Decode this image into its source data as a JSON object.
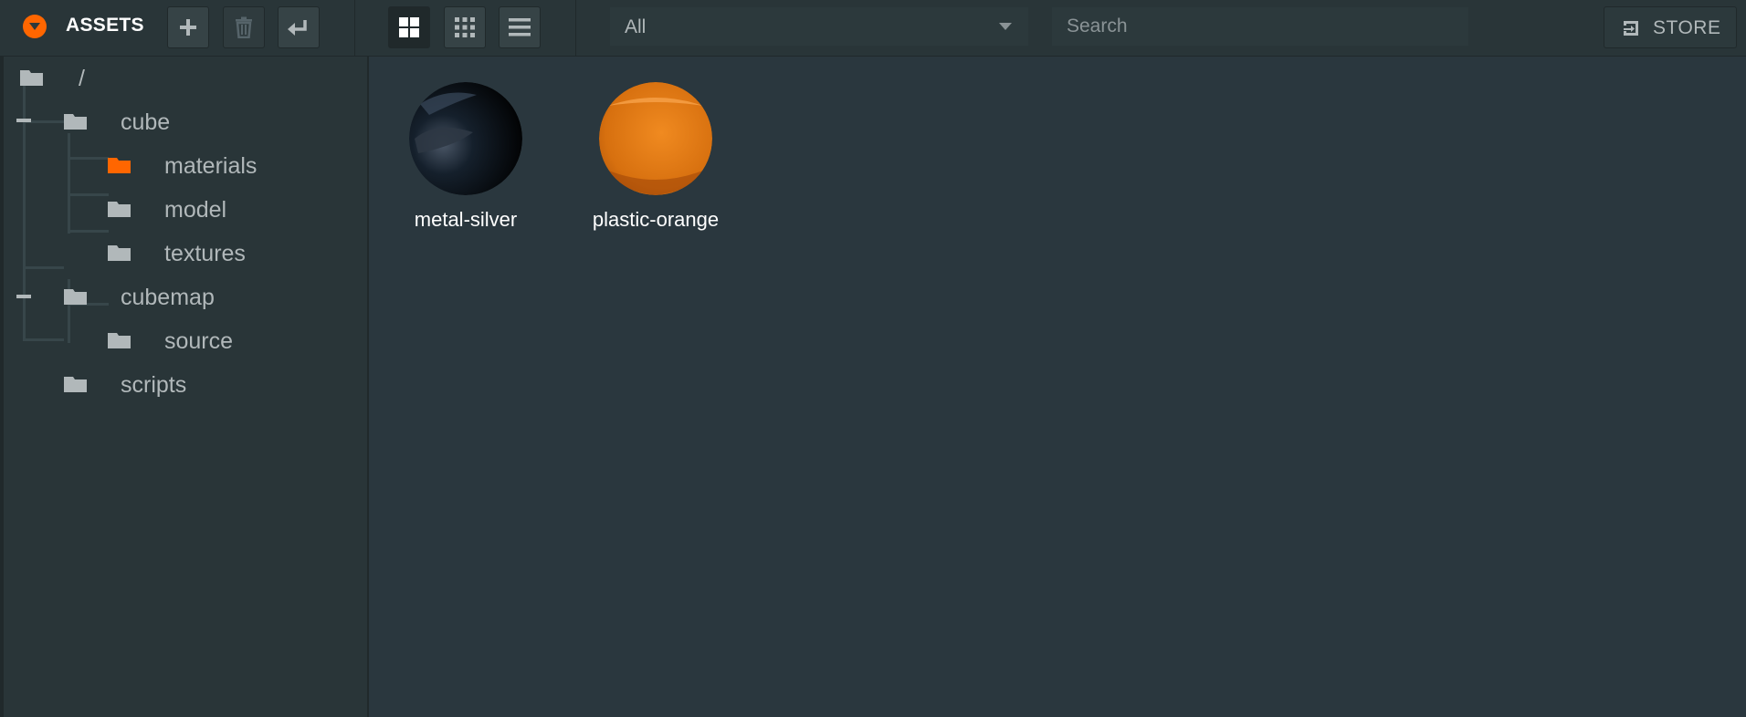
{
  "header": {
    "title": "ASSETS",
    "filter_value": "All",
    "search_placeholder": "Search",
    "store_label": "STORE"
  },
  "tree": {
    "root": "/",
    "items": [
      {
        "label": "cube"
      },
      {
        "label": "materials"
      },
      {
        "label": "model"
      },
      {
        "label": "textures"
      },
      {
        "label": "cubemap"
      },
      {
        "label": "source"
      },
      {
        "label": "scripts"
      }
    ]
  },
  "assets": [
    {
      "name": "metal-silver"
    },
    {
      "name": "plastic-orange"
    }
  ],
  "colors": {
    "accent": "#ff6600",
    "folder": "#b1b8ba",
    "background": "#2a373e"
  }
}
